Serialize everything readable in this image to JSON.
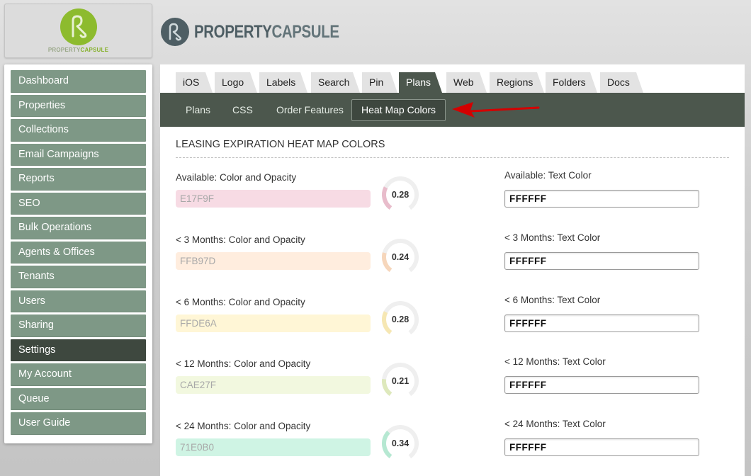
{
  "header": {
    "logo_box": {
      "text_part1": "PROPERTY",
      "text_part2": "CAPSULE",
      "icon": "property-capsule-logo-icon"
    },
    "brand": {
      "name_part1": "PROPERTY",
      "name_part2": "CAPSULE",
      "icon": "property-capsule-mark-icon"
    }
  },
  "sidebar": {
    "items": [
      {
        "label": "Dashboard",
        "active": false
      },
      {
        "label": "Properties",
        "active": false
      },
      {
        "label": "Collections",
        "active": false
      },
      {
        "label": "Email Campaigns",
        "active": false
      },
      {
        "label": "Reports",
        "active": false
      },
      {
        "label": "SEO",
        "active": false
      },
      {
        "label": "Bulk Operations",
        "active": false
      },
      {
        "label": "Agents & Offices",
        "active": false
      },
      {
        "label": "Tenants",
        "active": false
      },
      {
        "label": "Users",
        "active": false
      },
      {
        "label": "Sharing",
        "active": false
      },
      {
        "label": "Settings",
        "active": true
      },
      {
        "label": "My Account",
        "active": false
      },
      {
        "label": "Queue",
        "active": false
      },
      {
        "label": "User Guide",
        "active": false
      }
    ]
  },
  "tabs": [
    {
      "label": "iOS",
      "active": false
    },
    {
      "label": "Logo",
      "active": false
    },
    {
      "label": "Labels",
      "active": false
    },
    {
      "label": "Search",
      "active": false
    },
    {
      "label": "Pin",
      "active": false
    },
    {
      "label": "Plans",
      "active": true
    },
    {
      "label": "Web",
      "active": false
    },
    {
      "label": "Regions",
      "active": false
    },
    {
      "label": "Folders",
      "active": false
    },
    {
      "label": "Docs",
      "active": false
    }
  ],
  "subtabs": [
    {
      "label": "Plans",
      "active": false
    },
    {
      "label": "CSS",
      "active": false
    },
    {
      "label": "Order Features",
      "active": false
    },
    {
      "label": "Heat Map Colors",
      "active": true
    }
  ],
  "section_title": "LEASING EXPIRATION HEAT MAP COLORS",
  "fields": [
    {
      "color_label": "Available: Color and Opacity",
      "color_value": "E17F9F",
      "opacity": "0.28",
      "text_label": "Available: Text Color",
      "text_value": "FFFFFF",
      "swatch": "#E17F9F"
    },
    {
      "color_label": "< 3 Months: Color and Opacity",
      "color_value": "FFB97D",
      "opacity": "0.24",
      "text_label": "< 3 Months: Text Color",
      "text_value": "FFFFFF",
      "swatch": "#FFB97D"
    },
    {
      "color_label": "< 6 Months: Color and Opacity",
      "color_value": "FFDE6A",
      "opacity": "0.28",
      "text_label": "< 6 Months: Text Color",
      "text_value": "FFFFFF",
      "swatch": "#FFDE6A"
    },
    {
      "color_label": "< 12 Months: Color and Opacity",
      "color_value": "CAE27F",
      "opacity": "0.21",
      "text_label": "< 12 Months: Text Color",
      "text_value": "FFFFFF",
      "swatch": "#CAE27F"
    },
    {
      "color_label": "< 24 Months: Color and Opacity",
      "color_value": "71E0B0",
      "opacity": "0.34",
      "text_label": "< 24 Months: Text Color",
      "text_value": "FFFFFF",
      "swatch": "#71E0B0"
    }
  ],
  "colors": {
    "nav_bg": "#7E9886",
    "nav_active_bg": "#3E483F",
    "tab_active_bg": "#4C574D",
    "accent_green": "#86B12C",
    "annotation_arrow": "#D40000"
  }
}
